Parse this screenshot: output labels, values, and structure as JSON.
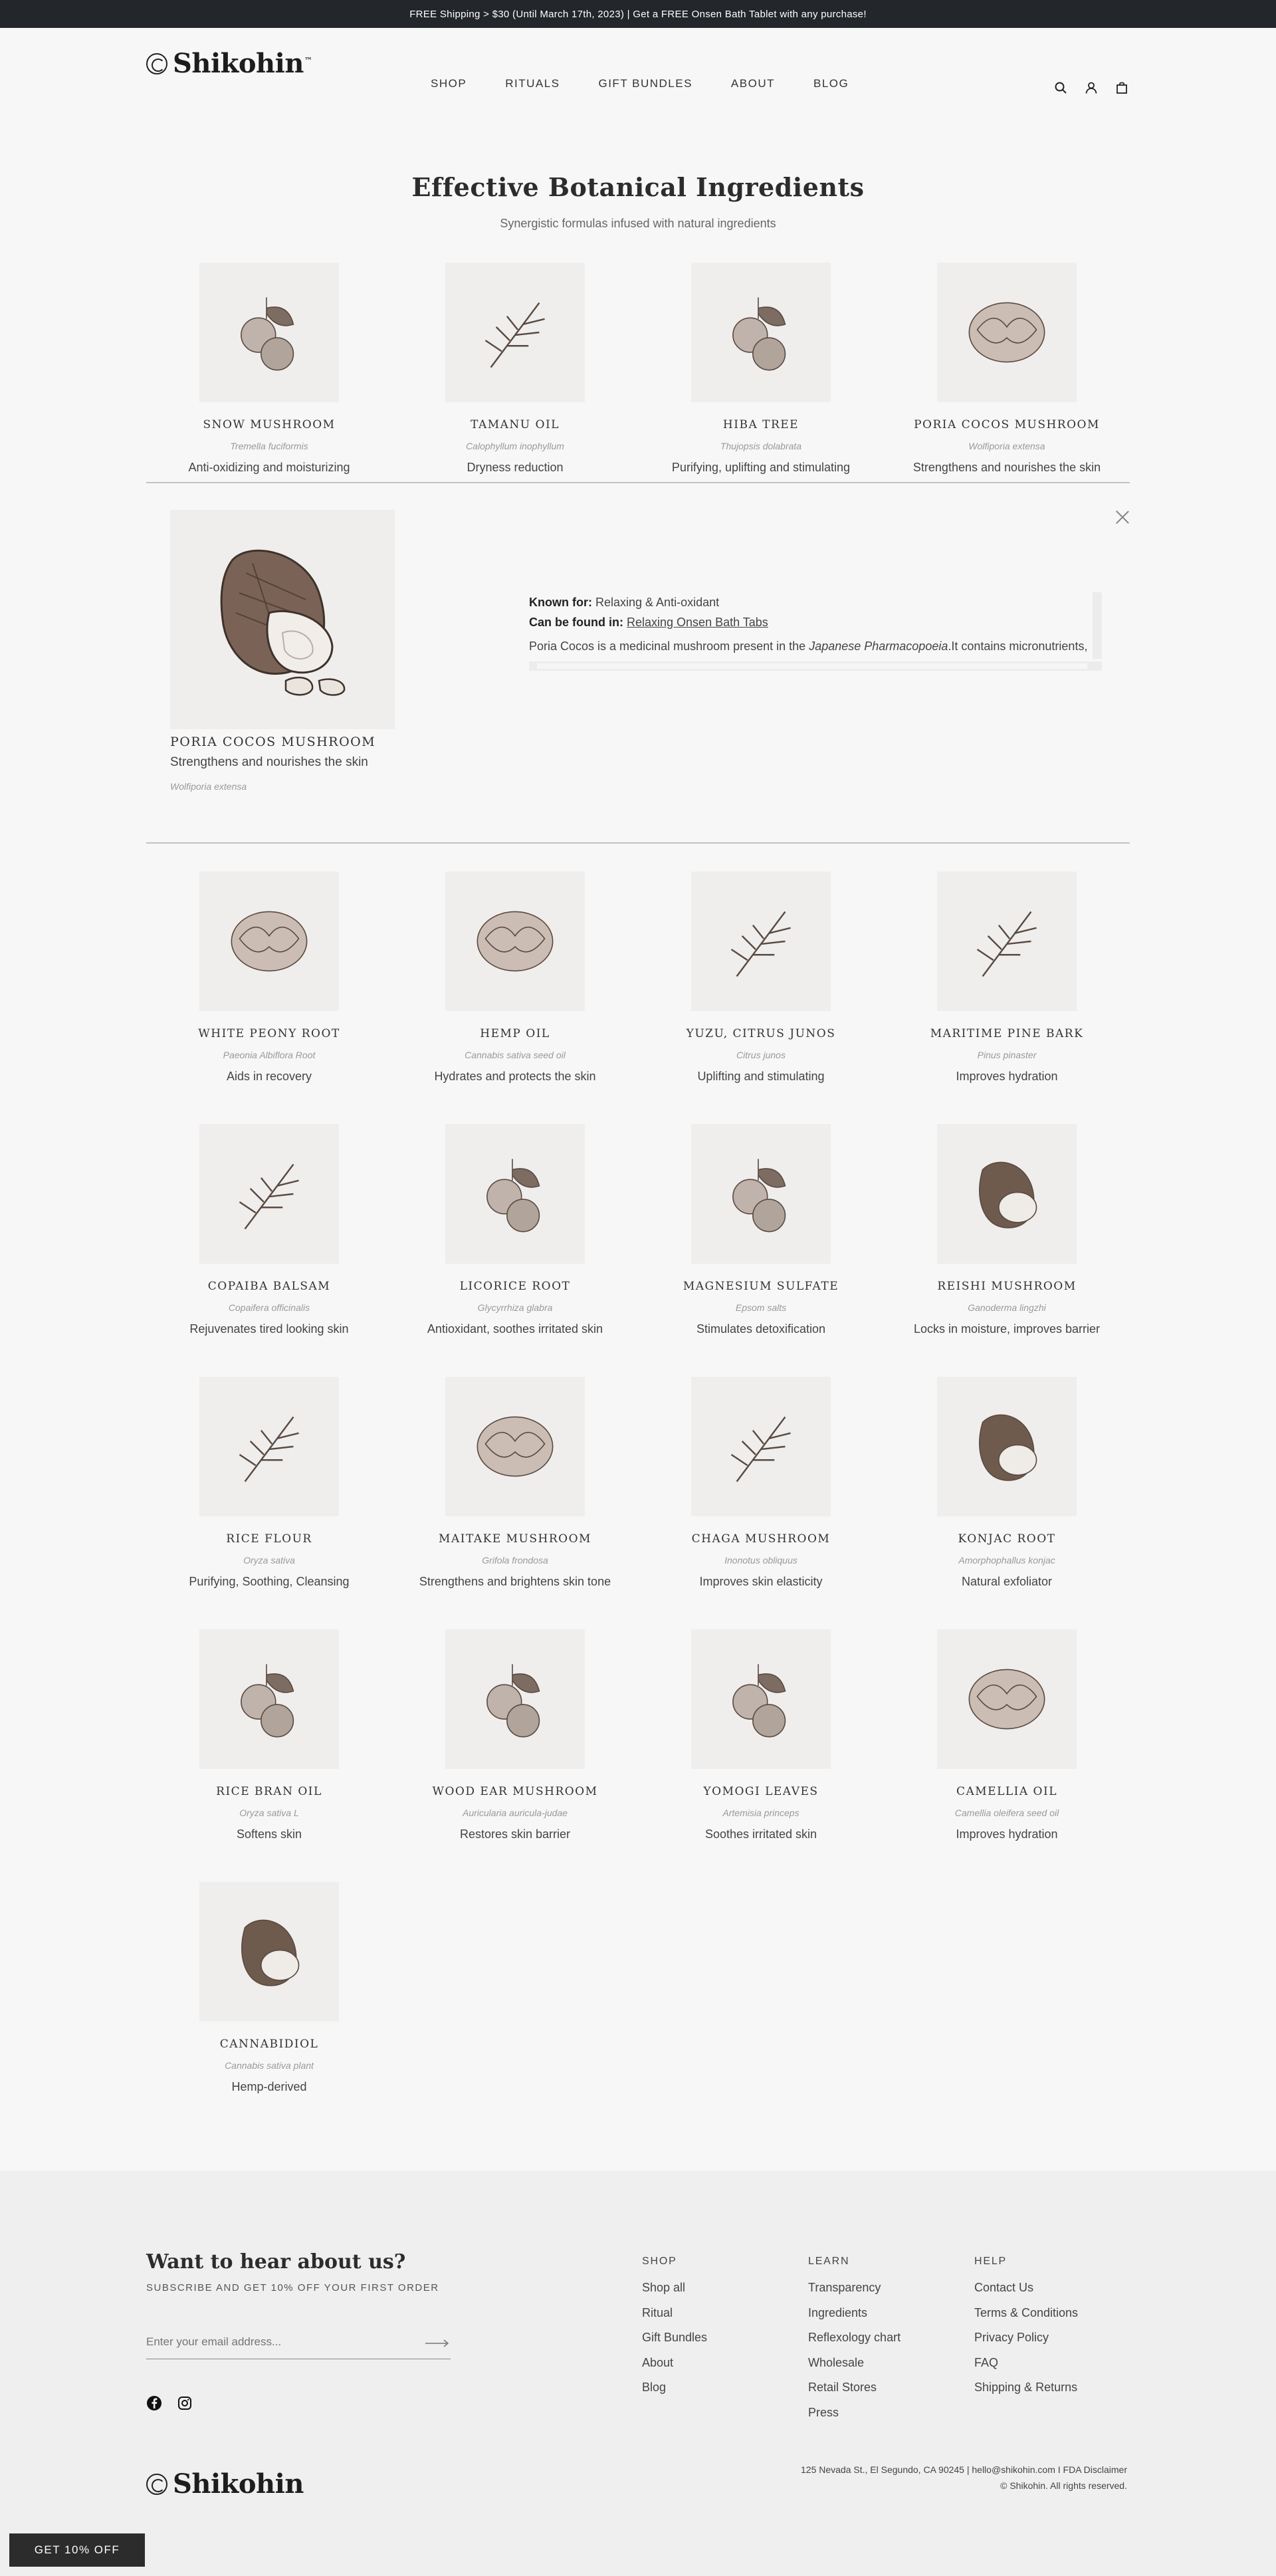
{
  "announcement": "FREE Shipping > $30 (Until March 17th, 2023) | Get a FREE Onsen Bath Tablet with any purchase!",
  "brand": {
    "name": "Shikohin",
    "tm": "™"
  },
  "nav": [
    "SHOP",
    "RITUALS",
    "GIFT BUNDLES",
    "ABOUT",
    "BLOG"
  ],
  "header_icons": [
    "search-icon",
    "account-icon",
    "bag-icon"
  ],
  "section": {
    "title": "Effective Botanical Ingredients",
    "subtitle": "Synergistic formulas infused with natural ingredients"
  },
  "top_ingredients": [
    {
      "name": "SNOW MUSHROOM",
      "latin": "Tremella fuciformis",
      "benefit": "Anti-oxidizing and moisturizing",
      "icon": "snow-mushroom-illustration"
    },
    {
      "name": "TAMANU OIL",
      "latin": "Calophyllum inophyllum",
      "benefit": "Dryness reduction",
      "icon": "tamanu-fruit-illustration"
    },
    {
      "name": "HIBA TREE",
      "latin": "Thujopsis dolabrata",
      "benefit": "Purifying, uplifting and stimulating",
      "icon": "hiba-branch-illustration"
    },
    {
      "name": "PORIA COCOS MUSHROOM",
      "latin": "Wolfiporia extensa",
      "benefit": "Strengthens and nourishes the skin",
      "icon": "poria-cocos-illustration"
    }
  ],
  "detail": {
    "name": "PORIA COCOS MUSHROOM",
    "benefit": "Strengthens and nourishes the skin",
    "latin": "Wolfiporia extensa",
    "known_for_label": "Known for:",
    "known_for": "Relaxing & Anti-oxidant",
    "found_in_label": "Can be found in:",
    "found_in": "Relaxing Onsen Bath Tabs",
    "desc_before": "Poria Cocos is a medicinal mushroom present in the ",
    "desc_italic": "Japanese Pharmacopoeia",
    "desc_after": ".It contains micronutrients, antioxidant properties that help nourish and hydrate the skin."
  },
  "bottom_ingredients": [
    {
      "name": "WHITE PEONY ROOT",
      "latin": "Paeonia Albiflora Root",
      "benefit": "Aids in recovery",
      "icon": "peony-root-illustration"
    },
    {
      "name": "HEMP OIL",
      "latin": "Cannabis sativa seed oil",
      "benefit": "Hydrates and protects the skin",
      "icon": "hemp-leaf-illustration"
    },
    {
      "name": "YUZU, CITRUS JUNOS",
      "latin": "Citrus junos",
      "benefit": "Uplifting and stimulating",
      "icon": "yuzu-illustration"
    },
    {
      "name": "MARITIME PINE BARK",
      "latin": "Pinus pinaster",
      "benefit": "Improves hydration",
      "icon": "pine-bark-illustration"
    },
    {
      "name": "COPAIBA BALSAM",
      "latin": "Copaifera officinalis",
      "benefit": "Rejuvenates tired looking skin",
      "icon": "copaiba-resin-illustration"
    },
    {
      "name": "LICORICE ROOT",
      "latin": "Glycyrrhiza glabra",
      "benefit": "Antioxidant, soothes irritated skin",
      "icon": "licorice-root-illustration"
    },
    {
      "name": "MAGNESIUM SULFATE",
      "latin": "Epsom salts",
      "benefit": "Stimulates detoxification",
      "icon": "epsom-salt-illustration"
    },
    {
      "name": "REISHI MUSHROOM",
      "latin": "Ganoderma lingzhi",
      "benefit": "Locks in moisture, improves barrier",
      "icon": "reishi-illustration"
    },
    {
      "name": "RICE FLOUR",
      "latin": "Oryza sativa",
      "benefit": "Purifying, Soothing, Cleansing",
      "icon": "rice-bowl-illustration"
    },
    {
      "name": "MAITAKE MUSHROOM",
      "latin": "Grifola frondosa",
      "benefit": "Strengthens and brightens skin tone",
      "icon": "maitake-illustration"
    },
    {
      "name": "CHAGA MUSHROOM",
      "latin": "Inonotus obliquus",
      "benefit": "Improves skin elasticity",
      "icon": "chaga-illustration"
    },
    {
      "name": "KONJAC ROOT",
      "latin": "Amorphophallus konjac",
      "benefit": "Natural exfoliator",
      "icon": "konjac-illustration"
    },
    {
      "name": "RICE BRAN OIL",
      "latin": "Oryza sativa L",
      "benefit": "Softens skin",
      "icon": "rice-bran-oil-illustration"
    },
    {
      "name": "WOOD EAR MUSHROOM",
      "latin": "Auricularia auricula-judae",
      "benefit": "Restores skin barrier",
      "icon": "wood-ear-illustration"
    },
    {
      "name": "YOMOGI LEAVES",
      "latin": "Artemisia princeps",
      "benefit": "Soothes irritated skin",
      "icon": "yomogi-illustration"
    },
    {
      "name": "CAMELLIA OIL",
      "latin": "Camellia oleifera seed oil",
      "benefit": "Improves hydration",
      "icon": "camellia-illustration"
    },
    {
      "name": "CANNABIDIOL",
      "latin": "Cannabis sativa plant",
      "benefit": "Hemp-derived",
      "icon": "dropper-illustration"
    }
  ],
  "footer": {
    "news_title": "Want to hear about us?",
    "news_sub": "SUBSCRIBE AND GET 10% OFF YOUR FIRST ORDER",
    "email_placeholder": "Enter your email address...",
    "columns": [
      {
        "heading": "SHOP",
        "links": [
          "Shop all",
          "Ritual",
          "Gift Bundles",
          "About",
          "Blog"
        ]
      },
      {
        "heading": "LEARN",
        "links": [
          "Transparency",
          "Ingredients",
          "Reflexology chart",
          "Wholesale",
          "Retail Stores",
          "Press"
        ]
      },
      {
        "heading": "HELP",
        "links": [
          "Contact Us",
          "Terms & Conditions",
          "Privacy Policy",
          "FAQ",
          "Shipping & Returns"
        ]
      }
    ],
    "address": "125 Nevada St., El Segundo, CA 90245 | hello@shikohin.com I FDA Disclaimer",
    "copyright": "© Shikohin. All rights reserved."
  },
  "promo_button": "GET 10% OFF",
  "colors": {
    "dark": "#23262b",
    "background": "#f7f7f7",
    "footer_bg": "#efefef",
    "ink": "#5a4a42"
  }
}
